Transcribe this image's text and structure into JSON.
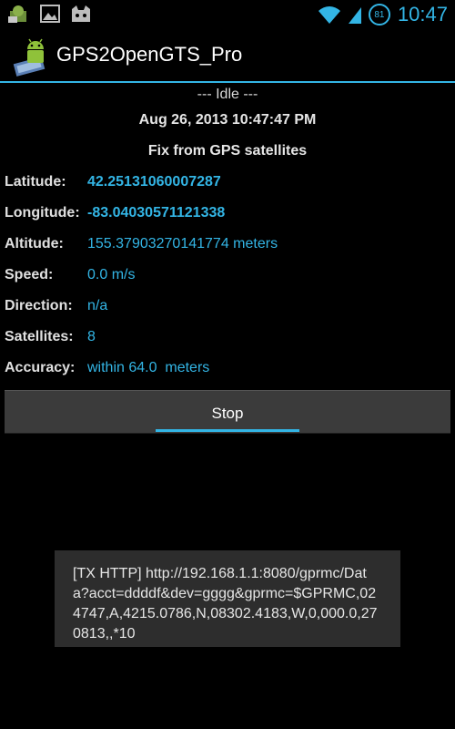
{
  "status_bar": {
    "time": "10:47",
    "battery_level": "81",
    "accent_color": "#33b5e5",
    "left_icons": [
      "app-notification-icon",
      "image-icon",
      "cat-icon"
    ],
    "right_icons": [
      "wifi-icon",
      "signal-icon",
      "battery-icon"
    ]
  },
  "action_bar": {
    "title": "GPS2OpenGTS_Pro",
    "icon": "android-app-icon"
  },
  "main": {
    "status": "--- Idle ---",
    "timestamp": "Aug 26, 2013 10:47:47 PM",
    "fix_source": "Fix from GPS satellites",
    "fields": [
      {
        "label": "Latitude:",
        "value": "42.25131060007287"
      },
      {
        "label": "Longitude:",
        "value": "-83.04030571121338"
      },
      {
        "label": "Altitude:",
        "value": "155.37903270141774 meters"
      },
      {
        "label": "Speed:",
        "value": "0.0 m/s"
      },
      {
        "label": "Direction:",
        "value": "n/a"
      },
      {
        "label": "Satellites:",
        "value": "8"
      },
      {
        "label": "Accuracy:",
        "value": "within 64.0  meters"
      }
    ],
    "stop_button": "Stop"
  },
  "toast": {
    "message": "[TX HTTP] http://192.168.1.1:8080/gprmc/Data?acct=ddddf&dev=gggg&gprmc=$GPRMC,024747,A,4215.0786,N,08302.4183,W,0,000.0,270813,,*10"
  }
}
